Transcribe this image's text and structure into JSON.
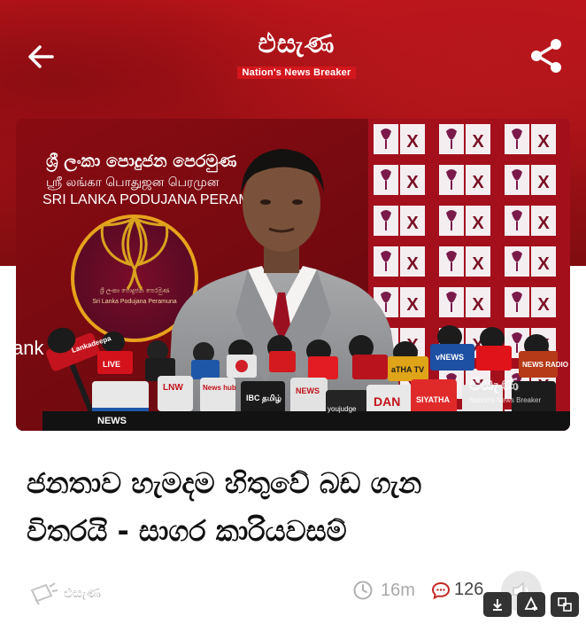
{
  "brand": {
    "name": "එසැණ",
    "tagline": "Nation's News Breaker"
  },
  "photo": {
    "party_si": "ශ්‍රී ලංකා පොදුජන පෙරමුණ",
    "party_ta": "ஸ்ரீ லங்கா பொதுஜன பெரமுன",
    "party_en": "SRI LANKA PODUJANA PERAMUNA",
    "seal_line1": "ශ්‍රී ලංකා පොදුජන පෙරමුණ",
    "seal_line2": "Sri Lanka Podujana Peramuna",
    "ballot_mark": "X",
    "side_text": "ank",
    "watermark": "එසැණ",
    "watermark_tag": "Nation's News Breaker",
    "mic_labels": [
      "Lankadeepa",
      "LIVE",
      "LNW",
      "News hub",
      "IBC தமிழ்",
      "NEWS",
      "youjudge",
      "DAN",
      "NEWS",
      "SIYATHA",
      "aTHA TV",
      "NEWS RADIO",
      "vNEWS"
    ]
  },
  "headline": {
    "line1": "ජනතාව හැමදම හිතුවේ බඩ ගැන",
    "line2": "විතරයි - සාගර කාරියවසම්"
  },
  "meta": {
    "source": "එසැණ",
    "time": "16m",
    "comments": "126"
  },
  "icons": {
    "back": "arrow-left-icon",
    "share": "share-icon",
    "clock": "clock-icon",
    "comment": "comment-icon",
    "mute": "speaker-icon",
    "download": "download-icon",
    "shield": "shield-icon",
    "translate": "translate-icon"
  },
  "colors": {
    "brand_red": "#c4161c",
    "headline": "#111111",
    "muted": "#a9a9a9"
  }
}
